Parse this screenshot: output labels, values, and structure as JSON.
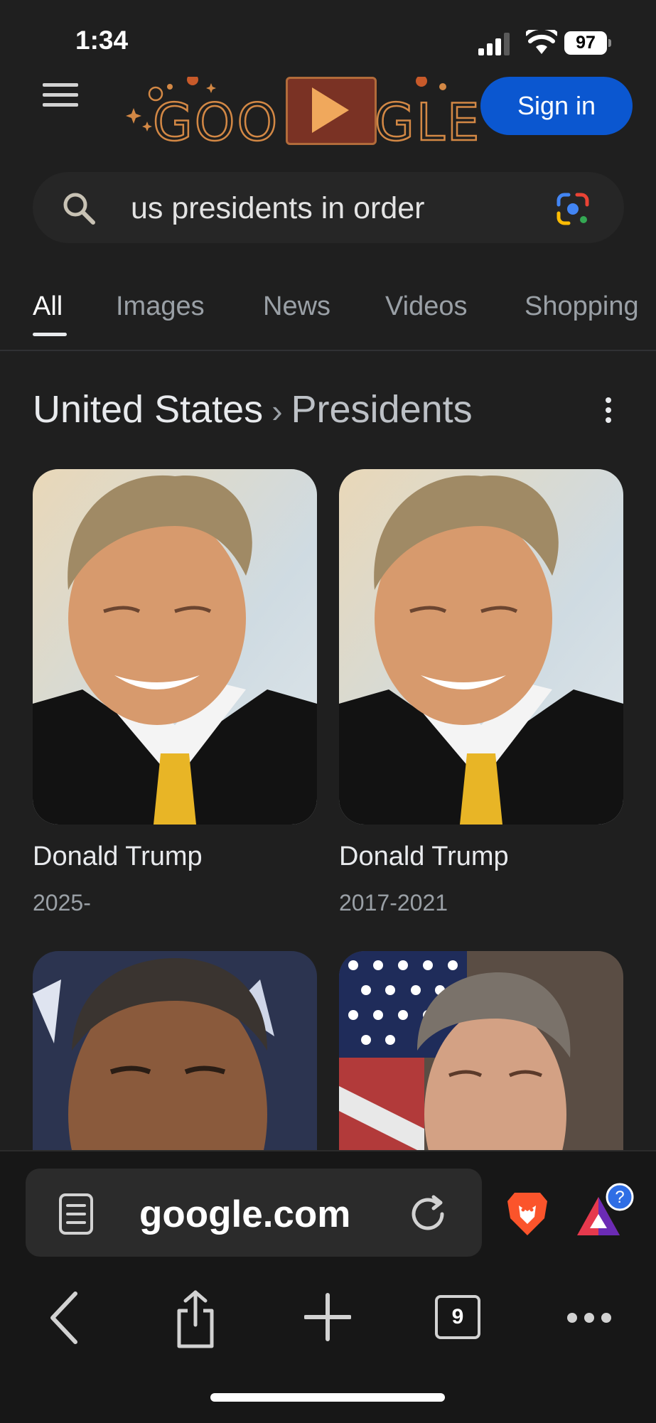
{
  "status_bar": {
    "time": "1:34",
    "battery_level": "97",
    "icons": [
      "signal-icon",
      "wifi-icon",
      "battery-icon"
    ]
  },
  "header": {
    "menu_icon": "hamburger-icon",
    "logo_doodle_text": "GOOGLE",
    "sign_in_label": "Sign in",
    "accent_color": "#0b57d0"
  },
  "search": {
    "query": "us presidents in order",
    "icons": [
      "search-icon",
      "google-lens-icon"
    ]
  },
  "tabs": [
    {
      "label": "All",
      "active": true
    },
    {
      "label": "Images",
      "active": false
    },
    {
      "label": "News",
      "active": false
    },
    {
      "label": "Videos",
      "active": false
    },
    {
      "label": "Shopping",
      "active": false
    }
  ],
  "knowledge": {
    "breadcrumb_root": "United States",
    "breadcrumb_separator": "›",
    "breadcrumb_current": "Presidents",
    "more_icon": "more-vert-icon"
  },
  "presidents": [
    {
      "name": "Donald Trump",
      "years": "2025-"
    },
    {
      "name": "Donald Trump",
      "years": "2017-2021"
    },
    {
      "name": "",
      "years": ""
    },
    {
      "name": "",
      "years": ""
    }
  ],
  "browser": {
    "url": "google.com",
    "tab_count": "9",
    "icons": [
      "reader-mode-icon",
      "reload-icon",
      "brave-shields-icon",
      "brave-rewards-icon",
      "back-icon",
      "share-icon",
      "new-tab-icon",
      "tabs-icon",
      "more-options-icon"
    ]
  }
}
